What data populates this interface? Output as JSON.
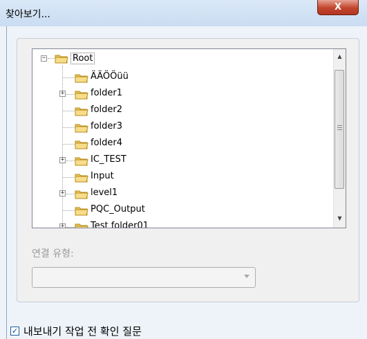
{
  "window": {
    "title": "찾아보기...",
    "close_symbol": "X"
  },
  "tree": {
    "root_label": "Root",
    "items": [
      {
        "label": "ÄÄÖÖüü",
        "expandable": false
      },
      {
        "label": "folder1",
        "expandable": true
      },
      {
        "label": "folder2",
        "expandable": false
      },
      {
        "label": "folder3",
        "expandable": false
      },
      {
        "label": "folder4",
        "expandable": false
      },
      {
        "label": "IC_TEST",
        "expandable": true
      },
      {
        "label": "Input",
        "expandable": false
      },
      {
        "label": "level1",
        "expandable": true
      },
      {
        "label": "PQC_Output",
        "expandable": false
      },
      {
        "label": "Test folder01",
        "expandable": true
      }
    ]
  },
  "connection": {
    "label": "연결 유형:",
    "value": ""
  },
  "ask_before_export": {
    "label": "내보내기 작업 전 확인 질문",
    "checked": true
  }
}
